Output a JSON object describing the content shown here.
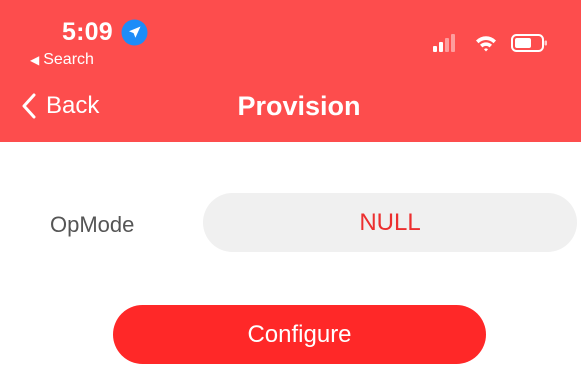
{
  "status_bar": {
    "time": "5:09",
    "location_icon": "location-arrow-icon",
    "back_app_label": "Search",
    "signal_icon": "cellular-signal-icon",
    "wifi_icon": "wifi-icon",
    "battery_icon": "battery-icon"
  },
  "nav": {
    "back_label": "Back",
    "title": "Provision"
  },
  "form": {
    "opmode_label": "OpMode",
    "opmode_value": "NULL"
  },
  "actions": {
    "configure_label": "Configure"
  },
  "colors": {
    "header_bg": "#fd4d4d",
    "accent": "#ff2828",
    "value_text": "#ec2f2f",
    "field_bg": "#f0f0f0"
  }
}
